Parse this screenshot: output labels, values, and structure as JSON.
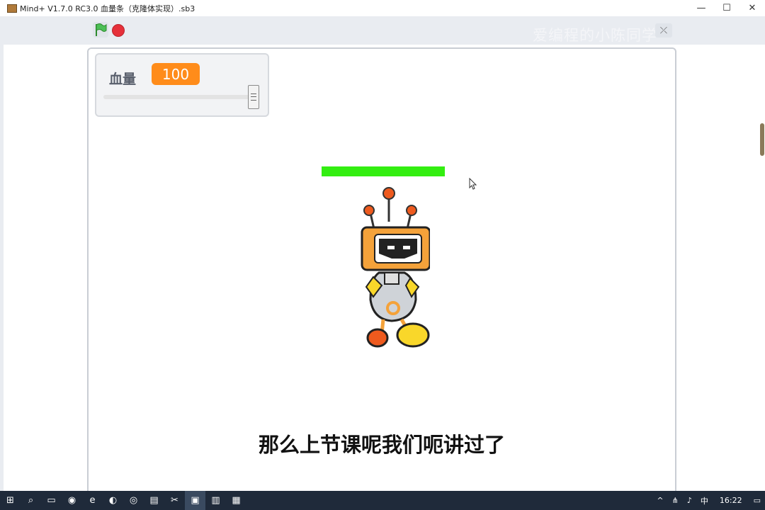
{
  "window": {
    "title": "Mind+ V1.7.0 RC3.0   血量条（克隆体实现）.sb3",
    "minimize": "—",
    "maximize": "☐",
    "close": "✕"
  },
  "toolbar": {
    "flag_icon": "green-flag-icon",
    "stop_icon": "stop-icon",
    "fullscreen_icon": "fullscreen-exit-icon",
    "watermark": "爱编程的小陈同学"
  },
  "variable": {
    "name": "血量",
    "value": "100",
    "slider_fraction": 1.0,
    "color": "#ff8c1a"
  },
  "health_bar": {
    "fraction": 1.0,
    "color": "#33ee11"
  },
  "subtitle": "那么上节课呢我们呃讲过了",
  "taskbar": {
    "clock": "16:22",
    "ime": "中",
    "icons": [
      "windows-start-icon",
      "search-icon",
      "task-view-icon",
      "browser-icon",
      "edge-icon",
      "wechat-icon",
      "chrome-icon",
      "file-explorer-icon",
      "capcut-icon",
      "mindplus-icon",
      "notepad-icon",
      "screen-recorder-icon"
    ]
  }
}
